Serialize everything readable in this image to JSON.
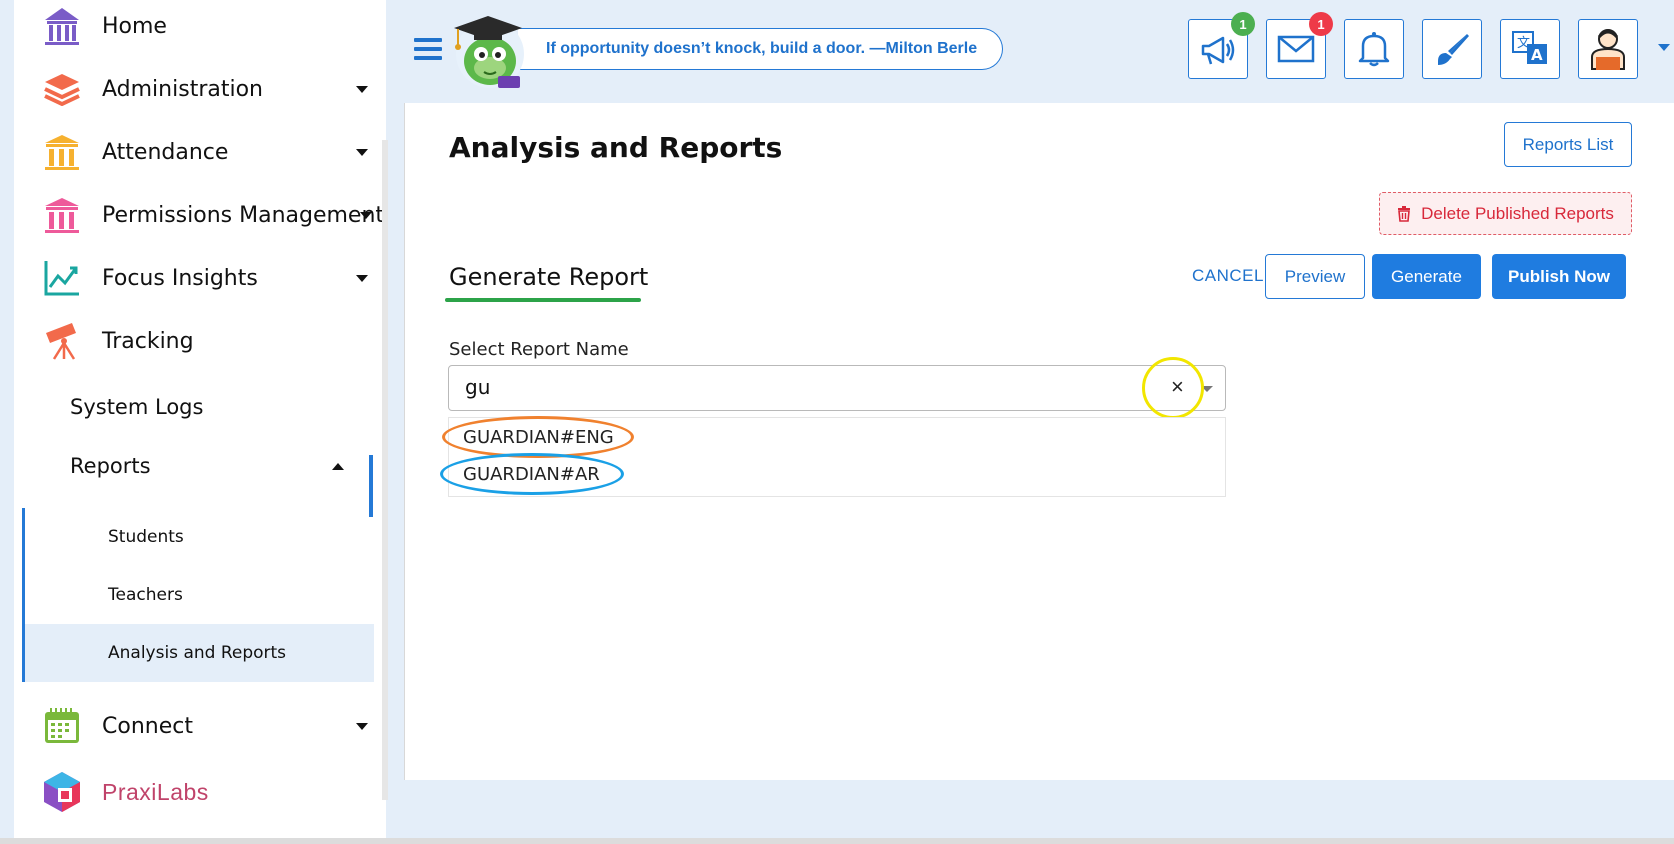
{
  "sidebar": {
    "items": [
      {
        "label": "Home",
        "icon": "home-icon",
        "color": "#7a5cc7"
      },
      {
        "label": "Administration",
        "icon": "layers-icon",
        "color": "#f26a4b"
      },
      {
        "label": "Attendance",
        "icon": "columns-icon",
        "color": "#f6b12f"
      },
      {
        "label": "Permissions Management",
        "icon": "columns-icon",
        "color": "#ee5a9a"
      },
      {
        "label": "Focus Insights",
        "icon": "chart-icon",
        "color": "#1aa6a0"
      },
      {
        "label": "Tracking",
        "icon": "telescope-icon",
        "color": "#f26a4b"
      }
    ],
    "sub": [
      {
        "label": "System Logs"
      },
      {
        "label": "Reports"
      }
    ],
    "reports_children": [
      {
        "label": "Students"
      },
      {
        "label": "Teachers"
      },
      {
        "label": "Analysis and Reports"
      }
    ],
    "connect": {
      "label": "Connect",
      "icon": "calendar-icon",
      "color": "#7ab83b"
    },
    "praxilabs": {
      "label": "PraxiLabs"
    }
  },
  "header": {
    "quote": "If opportunity doesn’t knock, build a door. —Milton Berle",
    "buttons": [
      {
        "name": "announcements-button",
        "icon": "megaphone-icon",
        "badge": "1",
        "badge_color": "green"
      },
      {
        "name": "messages-button",
        "icon": "mail-icon",
        "badge": "1",
        "badge_color": "red"
      },
      {
        "name": "notifications-button",
        "icon": "bell-icon",
        "badge": "",
        "badge_color": ""
      },
      {
        "name": "theme-button",
        "icon": "brush-icon",
        "badge": "",
        "badge_color": ""
      },
      {
        "name": "language-button",
        "icon": "translate-icon",
        "badge": "",
        "badge_color": ""
      },
      {
        "name": "profile-button",
        "icon": "teacher-avatar-icon",
        "badge": "",
        "badge_color": ""
      }
    ]
  },
  "main": {
    "title": "Analysis and Reports",
    "reports_list": "Reports List",
    "delete_published": "Delete Published Reports",
    "section_title": "Generate Report",
    "cancel": "CANCEL",
    "preview": "Preview",
    "generate": "Generate",
    "publish": "Publish Now",
    "field_label": "Select Report Name",
    "field_value": "gu",
    "clear": "×",
    "options": [
      "GUARDIAN#ENG",
      "GUARDIAN#AR"
    ]
  },
  "colors": {
    "accent": "#1f7ce0",
    "danger": "#d8283a",
    "underline": "#2ca349",
    "highlight_yellow": "#f2e600",
    "highlight_orange": "#f0812e",
    "highlight_blue": "#1aa0e6"
  }
}
